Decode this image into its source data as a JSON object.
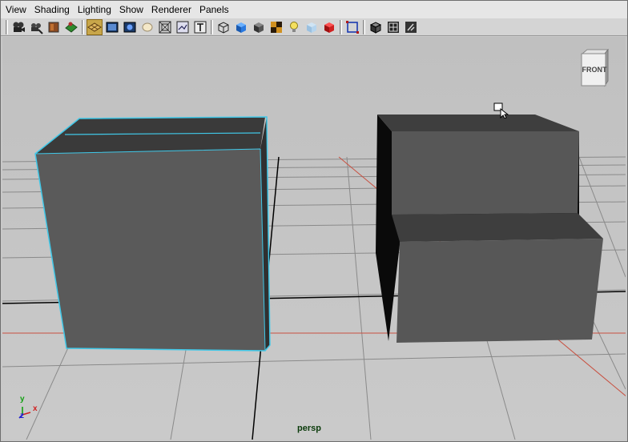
{
  "menus": [
    "View",
    "Shading",
    "Lighting",
    "Show",
    "Renderer",
    "Panels"
  ],
  "toolbar": {
    "buttons": [
      "camera-icon",
      "select-camera-icon",
      "bookmark-icon",
      "image-plane-icon",
      "grid-icon",
      "film-gate-icon",
      "resolution-gate-icon",
      "gate-mask-icon",
      "field-chart-icon",
      "safe-action-icon",
      "safe-title-icon",
      "wireframe-icon",
      "smooth-shade-icon",
      "flat-shade-icon",
      "textured-icon",
      "use-lights-icon",
      "xray-icon",
      "shadows-icon",
      "isolate-select-icon",
      "wireframe-on-shaded-icon",
      "backface-icon",
      "hud-icon"
    ],
    "active_button": "grid-icon"
  },
  "viewport": {
    "camera": "persp",
    "viewcube_face": "FRONT",
    "axis_labels": {
      "y": "y",
      "x": "x",
      "z": "z"
    },
    "colors": {
      "background": "#c8c8c8",
      "grid": "#8c8c8c",
      "axis_red": "#c85040",
      "selection": "#40c8e8",
      "object": "#5a5a5a"
    }
  }
}
